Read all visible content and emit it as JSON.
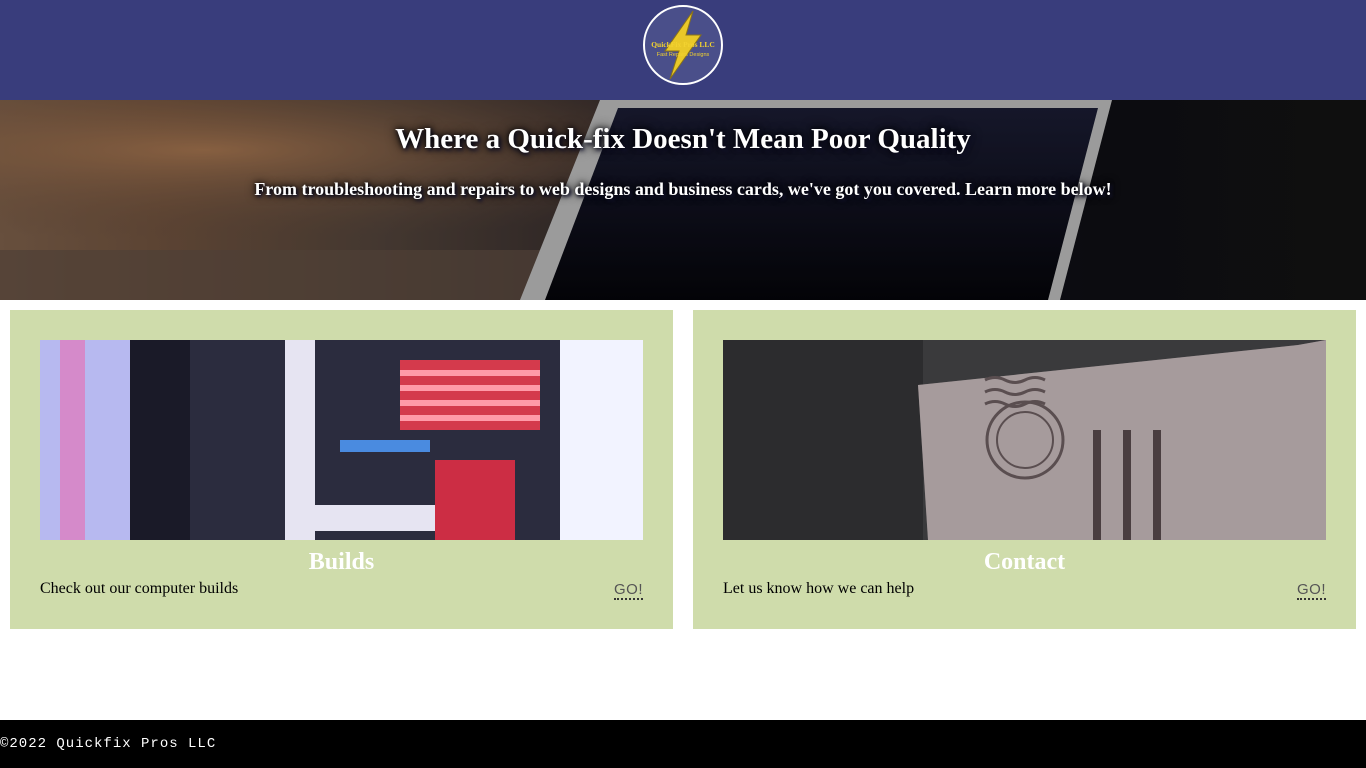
{
  "header": {
    "logo": {
      "line1": "QuickFix Pros LLC",
      "line2": "Fast Repairs Designs",
      "bg_color": "#4a4f8a",
      "text_color": "#f2d230",
      "icon": "lightning-bolt-icon"
    },
    "bg_color": "#393d7c"
  },
  "hero": {
    "title": "Where a Quick-fix Doesn't Mean Poor Quality",
    "subtitle": "From troubleshooting and repairs to web designs and business cards, we've got you covered. Learn more below!"
  },
  "cards": [
    {
      "title": "Builds",
      "description": "Check out our computer builds",
      "link_label": "GO!",
      "image_subject": "computer-build-photo"
    },
    {
      "title": "Contact",
      "description": "Let us know how we can help",
      "link_label": "GO!",
      "image_subject": "letter-envelope-photo"
    }
  ],
  "card_bg_color": "#cfdcab",
  "footer": {
    "copyright": "©2022 Quickfix Pros LLC",
    "bg_color": "#000000"
  }
}
